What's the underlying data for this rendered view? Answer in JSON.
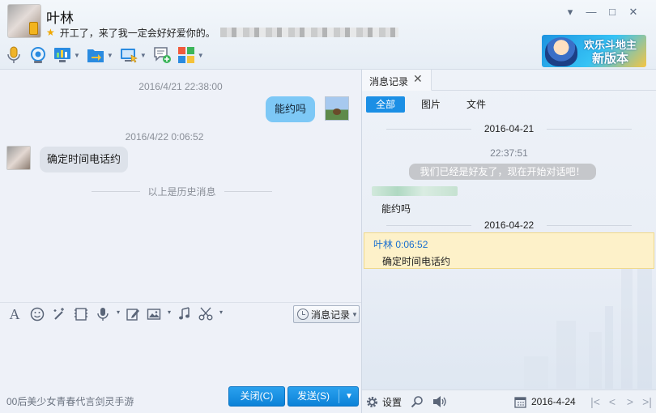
{
  "contact": {
    "name": "叶林",
    "signature": "开工了，来了我一定会好好爱你的。"
  },
  "window_controls": [
    "▾",
    "—",
    "□",
    "✕"
  ],
  "ad_banner": {
    "line1": "欢乐斗地主",
    "line2": "新版本"
  },
  "toolbar": {
    "icons": [
      "microphone-icon",
      "camera-icon",
      "screen-share-icon",
      "file-transfer-icon",
      "remote-desktop-icon",
      "new-chat-icon",
      "apps-icon"
    ]
  },
  "chat": {
    "messages": [
      {
        "timestamp": "2016/4/21 22:38:00",
        "text": "能约吗",
        "side": "right"
      },
      {
        "timestamp": "2016/4/22 0:06:52",
        "text": "确定时间电话约",
        "side": "left"
      }
    ],
    "history_divider": "以上是历史消息"
  },
  "input_tools": {
    "message_record_label": "消息记录"
  },
  "bottom_left": {
    "ad_text": "00后美少女青春代言剑灵手游",
    "close_label": "关闭(C)",
    "send_label": "发送(S)"
  },
  "history_panel": {
    "tab_label": "消息记录",
    "filters": [
      "全部",
      "图片",
      "文件"
    ],
    "date1": "2016-04-21",
    "time1": "22:37:51",
    "system_msg": "我们已经是好友了，现在开始对话吧！",
    "msg1": "能约吗",
    "date2": "2016-04-22",
    "hl_sender": "叶林  0:06:52",
    "hl_msg": "确定时间电话约",
    "settings_label": "设置",
    "date_value": "2016-4-24"
  },
  "colors": {
    "accent": "#1b8fe5",
    "my_bubble": "#7dc8f6",
    "friend_bubble": "#dde2ea",
    "highlight": "#fdf1c9"
  }
}
